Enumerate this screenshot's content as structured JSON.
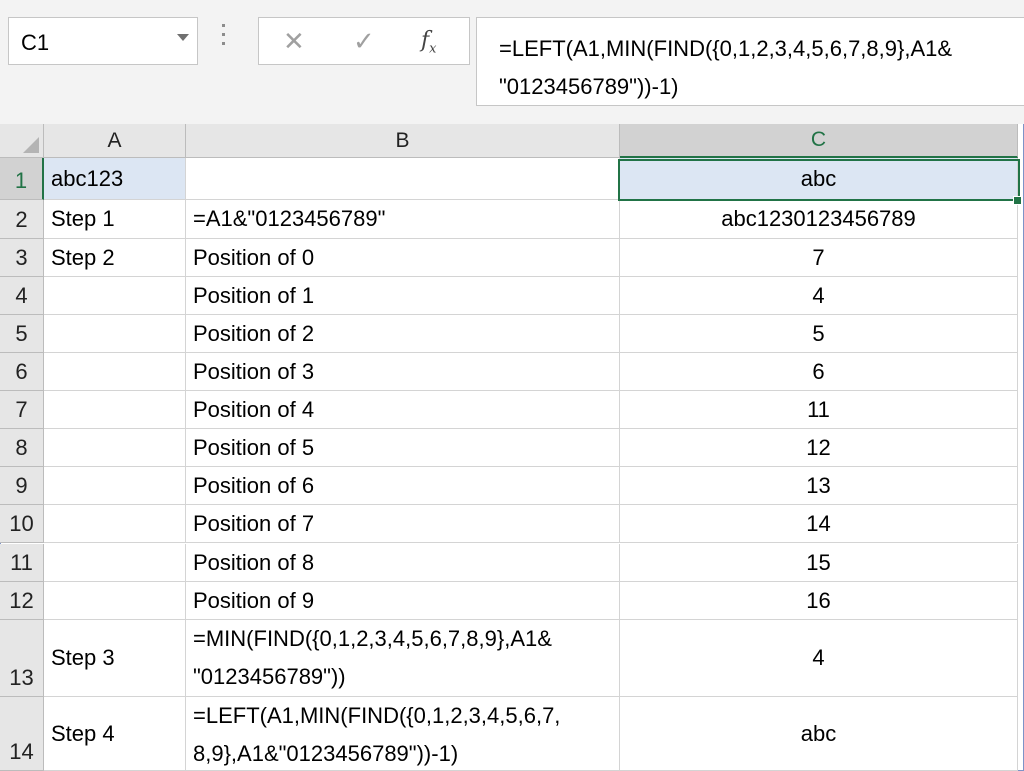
{
  "formula_bar": {
    "name_box": "C1",
    "fx_label": "fx",
    "formula_line1": "=LEFT(A1,MIN(FIND({0,1,2,3,4,5,6,7,8,9},A1&",
    "formula_line2": "\"0123456789\"))-1)"
  },
  "columns": [
    "A",
    "B",
    "C"
  ],
  "rows": [
    {
      "num": "1",
      "a": "abc123",
      "b": "",
      "c": "abc"
    },
    {
      "num": "2",
      "a": "Step 1",
      "b": "=A1&\"0123456789\"",
      "c": "abc1230123456789"
    },
    {
      "num": "3",
      "a": "Step 2",
      "b": "Position of 0",
      "c": "7"
    },
    {
      "num": "4",
      "a": "",
      "b": "Position of 1",
      "c": "4"
    },
    {
      "num": "5",
      "a": "",
      "b": "Position of 2",
      "c": "5"
    },
    {
      "num": "6",
      "a": "",
      "b": "Position of 3",
      "c": "6"
    },
    {
      "num": "7",
      "a": "",
      "b": "Position of 4",
      "c": "11"
    },
    {
      "num": "8",
      "a": "",
      "b": "Position of 5",
      "c": "12"
    },
    {
      "num": "9",
      "a": "",
      "b": "Position of 6",
      "c": "13"
    },
    {
      "num": "10",
      "a": "",
      "b": "Position of 7",
      "c": "14"
    },
    {
      "num": "11",
      "a": "",
      "b": "Position of 8",
      "c": "15"
    },
    {
      "num": "12",
      "a": "",
      "b": "Position of 9",
      "c": "16"
    },
    {
      "num": "13",
      "a": "Step 3",
      "b_line1": "=MIN(FIND({0,1,2,3,4,5,6,7,8,9},A1&",
      "b_line2": "\"0123456789\"))",
      "c": "4"
    },
    {
      "num": "14",
      "a": "Step 4",
      "b_line1": "=LEFT(A1,MIN(FIND({0,1,2,3,4,5,6,7,",
      "b_line2": "8,9},A1&\"0123456789\"))-1)",
      "c": "abc"
    }
  ],
  "colors": {
    "accent": "#217346",
    "selection_fill": "#dce6f3",
    "header_bg": "#e6e6e6"
  }
}
